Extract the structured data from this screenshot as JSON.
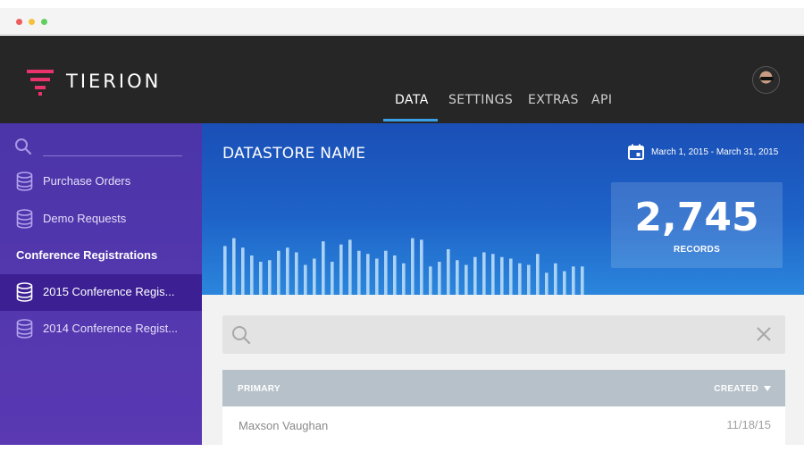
{
  "window": {
    "dots": [
      "#ee5d5d",
      "#f3c13a",
      "#5fcf5f"
    ]
  },
  "header": {
    "brand": "TIERION",
    "tabs": [
      {
        "label": "DATA",
        "active": true
      },
      {
        "label": "SETTINGS",
        "active": false
      },
      {
        "label": "EXTRAS",
        "active": false
      },
      {
        "label": "API",
        "active": false
      }
    ],
    "avatar_icon": "user-avatar"
  },
  "sidebar": {
    "search_placeholder": "",
    "items": [
      {
        "label": "Purchase Orders",
        "icon": "database-icon"
      },
      {
        "label": "Demo Requests",
        "icon": "database-icon"
      }
    ],
    "group_heading": "Conference Registrations",
    "group_items": [
      {
        "label": "2015 Conference Regis...",
        "icon": "database-icon",
        "selected": true
      },
      {
        "label": "2014 Conference Regist...",
        "icon": "database-icon",
        "selected": false
      }
    ]
  },
  "banner": {
    "datastore_name": "DATASTORE NAME",
    "date_range": "March 1, 2015 - March 31, 2015",
    "records_count": "2,745",
    "records_label": "RECORDS"
  },
  "chart_data": {
    "type": "bar",
    "values": [
      0.62,
      0.72,
      0.6,
      0.5,
      0.42,
      0.44,
      0.56,
      0.6,
      0.54,
      0.38,
      0.46,
      0.68,
      0.42,
      0.64,
      0.7,
      0.56,
      0.52,
      0.46,
      0.56,
      0.5,
      0.4,
      0.72,
      0.7,
      0.36,
      0.42,
      0.58,
      0.44,
      0.38,
      0.48,
      0.54,
      0.52,
      0.48,
      0.46,
      0.4,
      0.38,
      0.52,
      0.28,
      0.4,
      0.3,
      0.36,
      0.36
    ],
    "color": "#a9d2f3"
  },
  "search": {
    "placeholder": ""
  },
  "table": {
    "columns": [
      "PRIMARY",
      "CREATED"
    ],
    "rows": [
      {
        "primary": "Maxson Vaughan",
        "created": "11/18/15"
      }
    ]
  },
  "colors": {
    "topbar": "#262626",
    "sidebar": "#4b35a8",
    "sidebar_selected": "#3b1f93",
    "accent": "#3aa0e8",
    "logo": "#e8336d"
  }
}
